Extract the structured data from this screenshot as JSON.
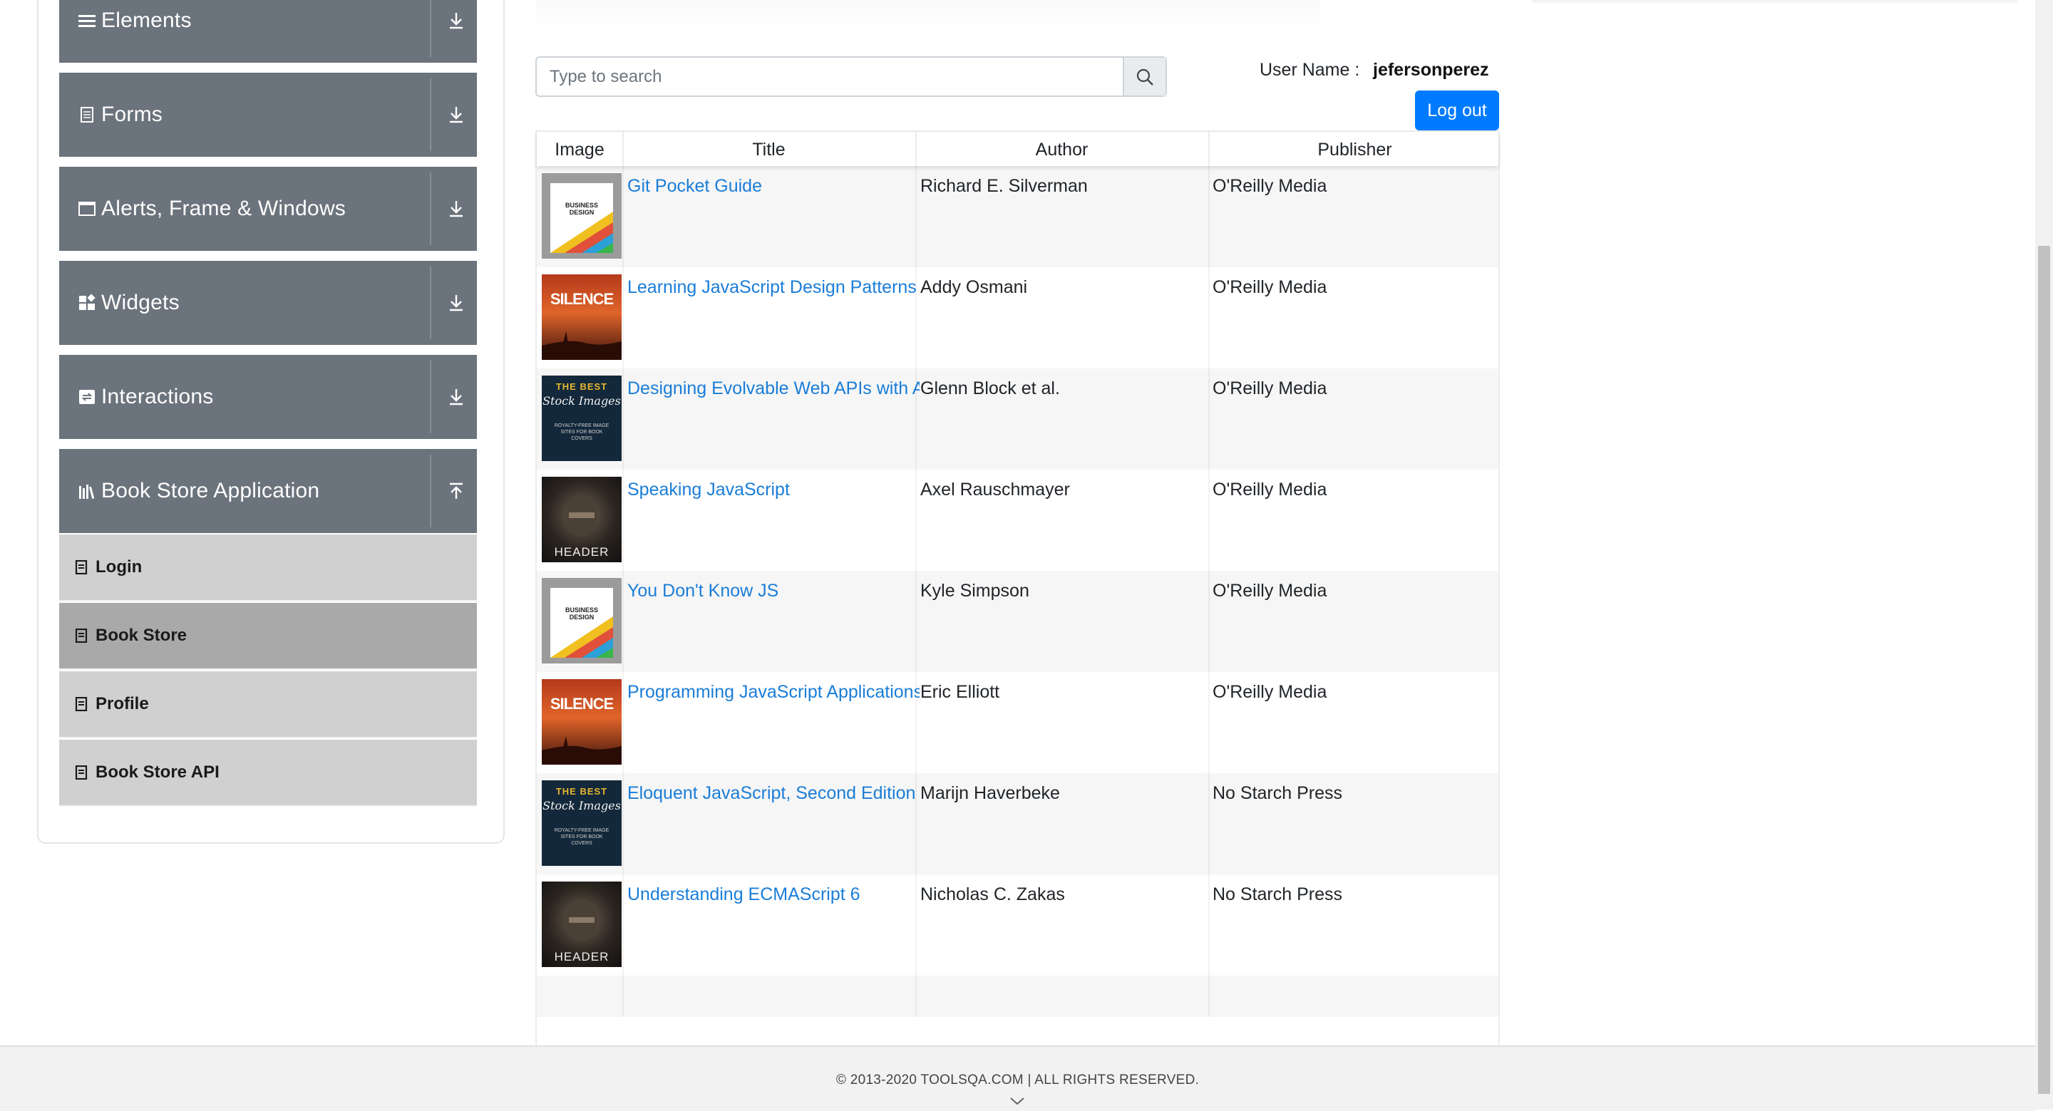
{
  "sidebar": {
    "groups": [
      {
        "label": "Elements",
        "icon": "hamburger-icon"
      },
      {
        "label": "Forms",
        "icon": "document-icon"
      },
      {
        "label": "Alerts, Frame & Windows",
        "icon": "window-icon"
      },
      {
        "label": "Widgets",
        "icon": "widgets-icon"
      },
      {
        "label": "Interactions",
        "icon": "interactions-icon"
      },
      {
        "label": "Book Store Application",
        "icon": "books-icon"
      }
    ],
    "items": [
      {
        "label": "Login"
      },
      {
        "label": "Book Store"
      },
      {
        "label": "Profile"
      },
      {
        "label": "Book Store API"
      }
    ]
  },
  "search": {
    "placeholder": "Type to search",
    "value": ""
  },
  "user": {
    "label": "User Name :",
    "name": "jefersonperez",
    "logout_label": "Log out"
  },
  "table": {
    "headers": [
      "Image",
      "Title",
      "Author",
      "Publisher"
    ],
    "rows": [
      {
        "cover": "business-design",
        "title": "Git Pocket Guide",
        "author": "Richard E. Silverman",
        "publisher": "O'Reilly Media"
      },
      {
        "cover": "silence",
        "title": "Learning JavaScript Design Patterns",
        "author": "Addy Osmani",
        "publisher": "O'Reilly Media"
      },
      {
        "cover": "best-stock-images",
        "title": "Designing Evolvable Web APIs with ASP.NET",
        "author": "Glenn Block et al.",
        "publisher": "O'Reilly Media"
      },
      {
        "cover": "header",
        "title": "Speaking JavaScript",
        "author": "Axel Rauschmayer",
        "publisher": "O'Reilly Media"
      },
      {
        "cover": "business-design",
        "title": "You Don't Know JS",
        "author": "Kyle Simpson",
        "publisher": "O'Reilly Media"
      },
      {
        "cover": "silence",
        "title": "Programming JavaScript Applications",
        "author": "Eric Elliott",
        "publisher": "O'Reilly Media"
      },
      {
        "cover": "best-stock-images",
        "title": "Eloquent JavaScript, Second Edition",
        "author": "Marijn Haverbeke",
        "publisher": "No Starch Press"
      },
      {
        "cover": "header",
        "title": "Understanding ECMAScript 6",
        "author": "Nicholas C. Zakas",
        "publisher": "No Starch Press"
      }
    ]
  },
  "covers": {
    "business_top": "BUSINESS",
    "business_bottom": "DESIGN",
    "silence": "SILENCE",
    "stock_top": "THE BEST",
    "stock_script": "Stock Images",
    "stock_sub": "ROYALTY-FREE IMAGE SITES FOR BOOK COVERS",
    "header": "HEADER"
  },
  "footer": {
    "text": "© 2013-2020 TOOLSQA.COM | ALL RIGHTS RESERVED."
  },
  "colors": {
    "accent": "#007bff",
    "link": "#1a7dd8",
    "sidebar_group": "#6b737c",
    "sidebar_item": "#d0d0d0",
    "sidebar_item_active": "#a9a9a9"
  }
}
